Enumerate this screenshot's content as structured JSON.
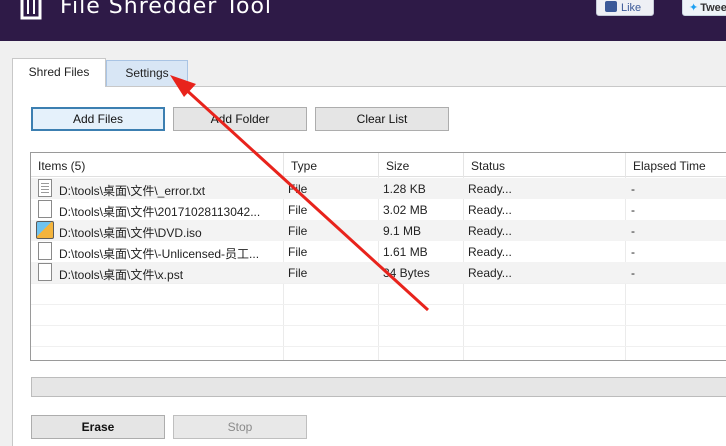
{
  "app": {
    "title": "File Shredder Tool",
    "facebook_label": "Like",
    "twitter_label": "Twee"
  },
  "tabs": [
    {
      "label": "Shred Files"
    },
    {
      "label": "Settings"
    }
  ],
  "toolbar": {
    "add_files": "Add Files",
    "add_folder": "Add Folder",
    "clear_list": "Clear List"
  },
  "list": {
    "columns": [
      "Items (5)",
      "Type",
      "Size",
      "Status",
      "Elapsed Time"
    ],
    "rows": [
      {
        "item": "D:\\tools\\桌面\\文件\\_error.txt",
        "type": "File",
        "size": "1.28 KB",
        "status": "Ready...",
        "elapsed": "-",
        "icon": "text-file-icon"
      },
      {
        "item": "D:\\tools\\桌面\\文件\\20171028113042...",
        "type": "File",
        "size": "3.02 MB",
        "status": "Ready...",
        "elapsed": "-",
        "icon": "file-icon"
      },
      {
        "item": "D:\\tools\\桌面\\文件\\DVD.iso",
        "type": "File",
        "size": "9.1 MB",
        "status": "Ready...",
        "elapsed": "-",
        "icon": "dvd-image-icon"
      },
      {
        "item": "D:\\tools\\桌面\\文件\\-Unlicensed-员工...",
        "type": "File",
        "size": "1.61 MB",
        "status": "Ready...",
        "elapsed": "-",
        "icon": "file-icon"
      },
      {
        "item": "D:\\tools\\桌面\\文件\\x.pst",
        "type": "File",
        "size": "34 Bytes",
        "status": "Ready...",
        "elapsed": "-",
        "icon": "file-icon"
      }
    ]
  },
  "actions": {
    "erase": "Erase",
    "stop": "Stop"
  },
  "colors": {
    "header_bg": "#2e1a47",
    "annotation_arrow": "#e8231c",
    "selected_button_border": "#3c7fb1"
  }
}
